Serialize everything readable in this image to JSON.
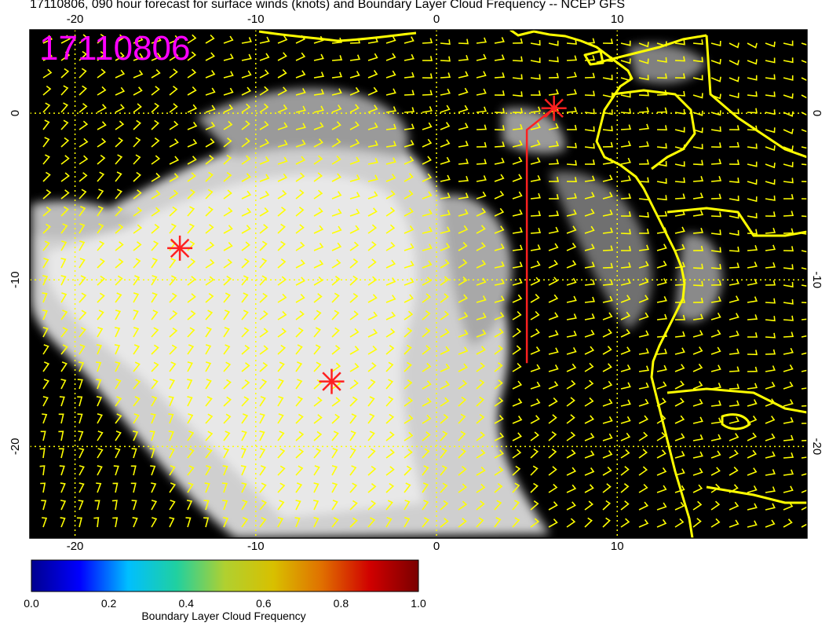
{
  "title": "17110806, 090 hour forecast for surface winds (knots) and Boundary Layer Cloud Frequency -- NCEP GFS",
  "map_label": "17110806",
  "axes": {
    "lon_ticks": [
      -20,
      -10,
      0,
      10
    ],
    "lat_ticks": [
      0,
      -10,
      -20
    ],
    "lon_range": [
      -22.5,
      20.5
    ],
    "lat_range": [
      -25.5,
      5
    ]
  },
  "markers": [
    {
      "name": "star-marker",
      "lon": -14.2,
      "lat": -8.1
    },
    {
      "name": "star-marker",
      "lon": -5.8,
      "lat": -16.1
    },
    {
      "name": "star-marker",
      "lon": 6.5,
      "lat": 0.3
    }
  ],
  "flight_track": [
    [
      5,
      -15
    ],
    [
      5,
      -1
    ],
    [
      6.5,
      0.3
    ]
  ],
  "colors": {
    "marker": "#ff2020",
    "coast": "#ffff00",
    "wind_barb": "#ffff00",
    "grid": "#ffff00",
    "label": "#ff00ff"
  },
  "colorbar": {
    "label": "Boundary Layer Cloud Frequency",
    "ticks": [
      "0.0",
      "0.2",
      "0.4",
      "0.6",
      "0.8",
      "1.0"
    ],
    "min": 0,
    "max": 1,
    "colormap": [
      "#00008f",
      "#0000ff",
      "#00bfff",
      "#20d0a0",
      "#b0d030",
      "#d8c000",
      "#e07000",
      "#d00000",
      "#7a0000"
    ]
  }
}
